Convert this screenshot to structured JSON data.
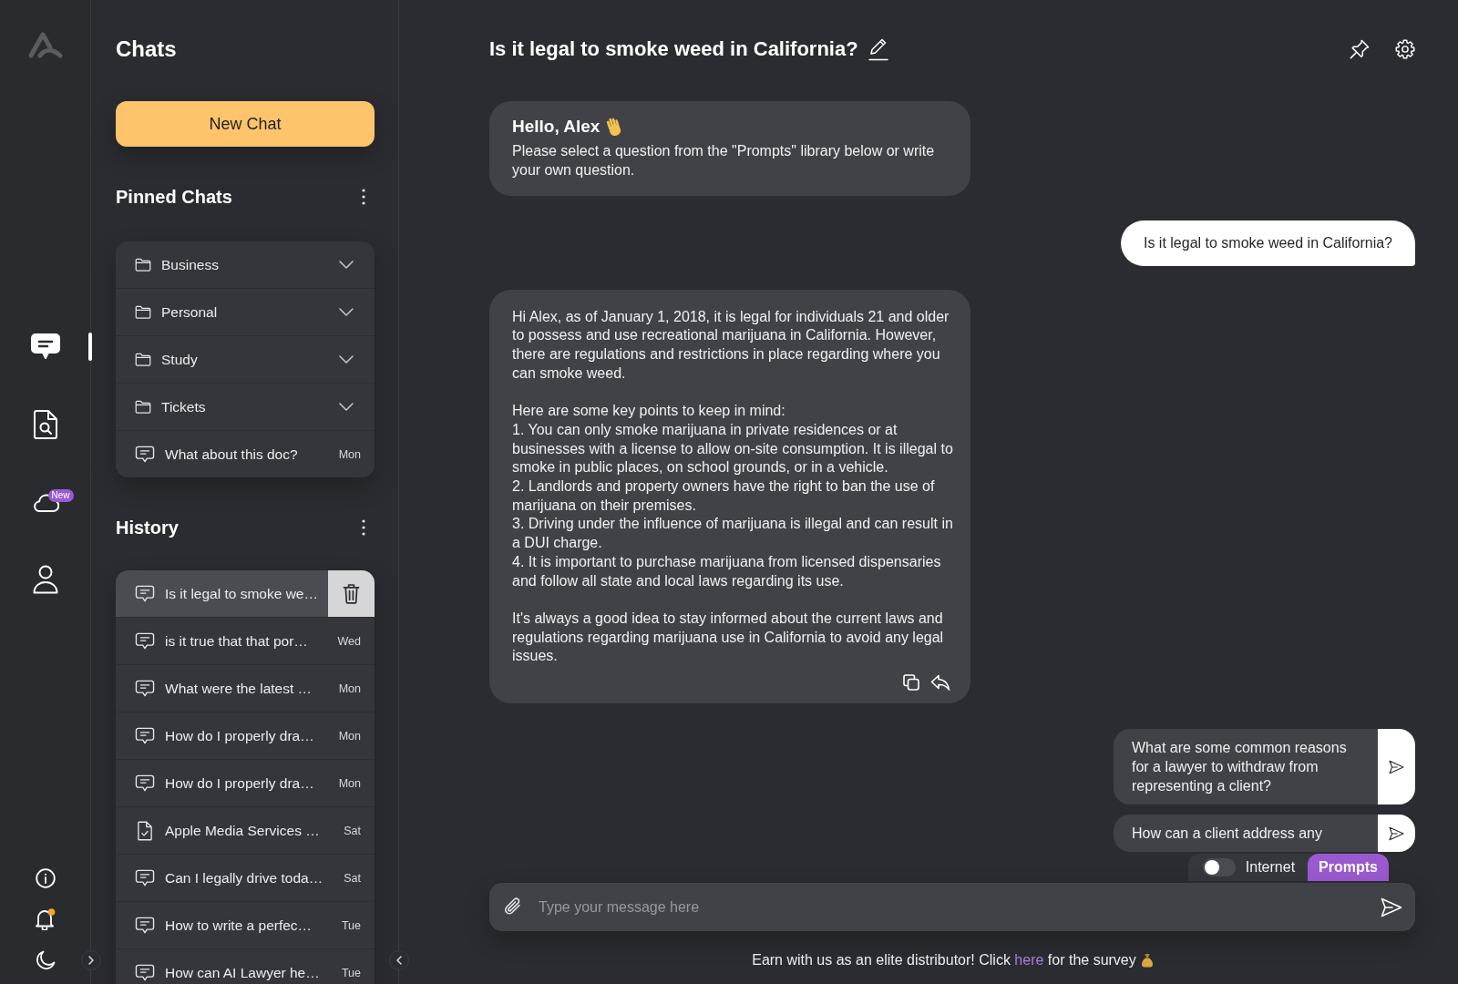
{
  "rail": {
    "items": [
      {
        "kind": "chats",
        "selected": true
      },
      {
        "kind": "documents",
        "selected": false
      },
      {
        "kind": "cloud",
        "selected": false,
        "badge": "New"
      },
      {
        "kind": "profile",
        "selected": false
      }
    ],
    "bottom_items": [
      {
        "kind": "info"
      },
      {
        "kind": "notifications",
        "unread": true
      },
      {
        "kind": "theme"
      }
    ]
  },
  "sidebar": {
    "title": "Chats",
    "new_chat_button": "New Chat",
    "pinned": {
      "title": "Pinned Chats",
      "items": [
        {
          "kind": "folder",
          "label": "Business"
        },
        {
          "kind": "folder",
          "label": "Personal"
        },
        {
          "kind": "folder",
          "label": "Study"
        },
        {
          "kind": "folder",
          "label": "Tickets"
        },
        {
          "kind": "chat",
          "label": "What about this doc?",
          "date": "Mon"
        }
      ]
    },
    "history": {
      "title": "History",
      "items": [
        {
          "kind": "chat",
          "label": "Is it legal to smoke we…",
          "selected": true
        },
        {
          "kind": "chat",
          "label": "is it true that that por…",
          "date": "Wed",
          "selected": false
        },
        {
          "kind": "chat",
          "label": "What were the latest …",
          "date": "Mon",
          "selected": false
        },
        {
          "kind": "chat",
          "label": "How do I properly dra…",
          "date": "Mon",
          "selected": false
        },
        {
          "kind": "chat",
          "label": "How do I properly dra…",
          "date": "Mon",
          "selected": false
        },
        {
          "kind": "document",
          "label": "Apple Media Services …",
          "date": "Sat",
          "selected": false
        },
        {
          "kind": "chat",
          "label": "Can I legally drive toda…",
          "date": "Sat",
          "selected": false
        },
        {
          "kind": "chat",
          "label": "How to write a perfec…",
          "date": "Tue",
          "selected": false
        },
        {
          "kind": "chat",
          "label": "How can AI Lawyer he…",
          "date": "Tue",
          "selected": false
        }
      ]
    }
  },
  "chat": {
    "title": "Is it legal to smoke weed in California?",
    "messages": [
      {
        "kind": "greeting",
        "heading": "Hello, Alex",
        "text": "Please select a question from the \"Prompts\" library below or write your own question."
      },
      {
        "kind": "user",
        "text": "Is it legal to smoke weed in California?"
      },
      {
        "kind": "answer",
        "paragraphs": [
          "Hi Alex, as of January 1, 2018, it is legal for individuals 21 and older to possess and use recreational marijuana in California. However, there are regulations and restrictions in place regarding where you can smoke weed.",
          "Here are some key points to keep in mind:\n1. You can only smoke marijuana in private residences or at businesses with a license to allow on-site consumption. It is illegal to smoke in public places, on school grounds, or in a vehicle.\n2. Landlords and property owners have the right to ban the use of marijuana on their premises.\n3. Driving under the influence of marijuana is illegal and can result in a DUI charge.\n4. It is important to purchase marijuana from licensed dispensaries and follow all state and local laws regarding its use.",
          "It's always a good idea to stay informed about the current laws and regulations regarding marijuana use in California to avoid any legal issues."
        ]
      }
    ],
    "suggestions": [
      "What are some common reasons for a lawyer to withdraw from representing a client?",
      "How can a client address any"
    ],
    "internet_toggle": {
      "label": "Internet",
      "on": false
    },
    "prompts_tab": {
      "label": "Prompts",
      "selected": true
    },
    "composer": {
      "placeholder": "Type your message here"
    },
    "footer": {
      "text": "Earn with us as an elite distributor! Click",
      "link": "here",
      "text_after": "for the survey"
    }
  }
}
